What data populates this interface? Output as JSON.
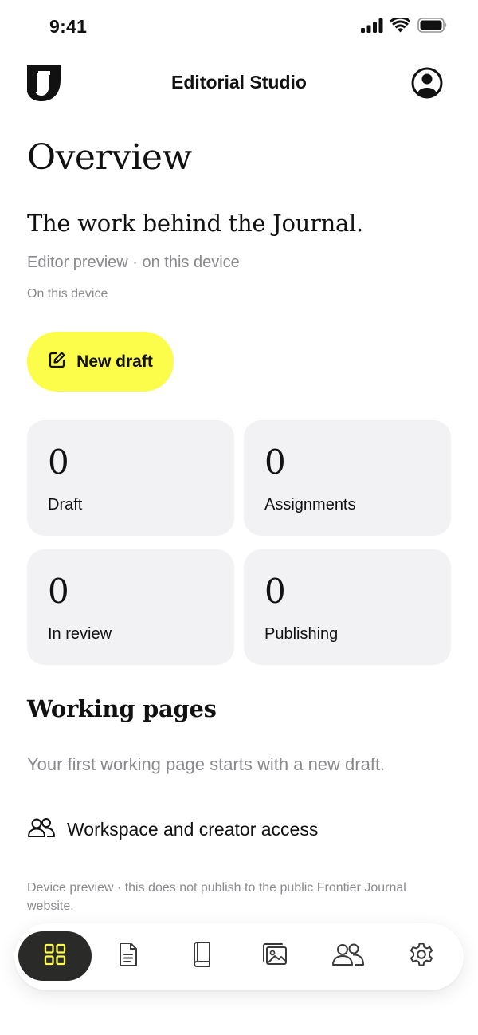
{
  "status_bar": {
    "time": "9:41",
    "icons": [
      "cellular-signal-icon",
      "wifi-icon",
      "battery-icon"
    ]
  },
  "header": {
    "logo": "frontier-journal-logo",
    "title": "Editorial Studio",
    "account_icon": "account-icon"
  },
  "overview": {
    "title": "Overview",
    "tagline": "The work behind the Journal.",
    "subtitle": "Editor preview · on this device",
    "device_note": "On this device"
  },
  "new_draft": {
    "label": "New draft",
    "icon": "compose-icon",
    "color": "#fcfc4a"
  },
  "stats": [
    {
      "value": "0",
      "label": "Draft"
    },
    {
      "value": "0",
      "label": "Assignments"
    },
    {
      "value": "0",
      "label": "In review"
    },
    {
      "value": "0",
      "label": "Publishing"
    }
  ],
  "working_pages": {
    "title": "Working pages",
    "empty_text": "Your first working page starts with a new draft."
  },
  "access_link": {
    "label": "Workspace and creator access",
    "icon": "people-icon"
  },
  "footnote": "Device preview · this does not publish to the public Frontier Journal website.",
  "tab_bar": {
    "active_index": 0,
    "active_background": "#2a2a28",
    "active_icon_color": "#fcfc4a",
    "items": [
      {
        "icon": "grid-icon"
      },
      {
        "icon": "document-icon"
      },
      {
        "icon": "book-icon"
      },
      {
        "icon": "image-gallery-icon"
      },
      {
        "icon": "people-icon"
      },
      {
        "icon": "gear-icon"
      }
    ]
  }
}
